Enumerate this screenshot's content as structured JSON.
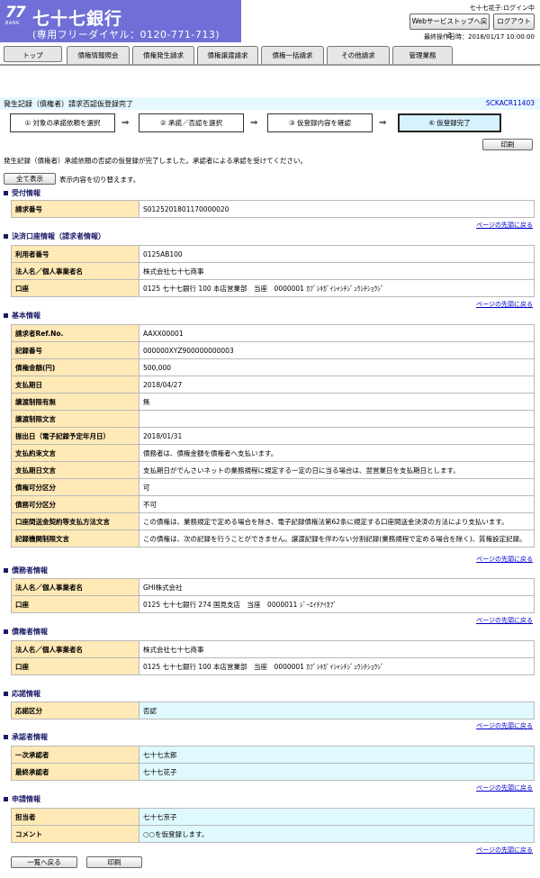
{
  "header": {
    "logo_number": "77",
    "logo_bank": "BANK",
    "bank_name": "七十七銀行",
    "dial": "(専用フリーダイヤル：0120-771-713)",
    "user_status": "七十七花子:ログイン中",
    "websvc_button": "Webサービストップへ戻る",
    "logout_button": "ログアウト",
    "last_operation": "最終操作日時：2018/01/17 10:00:00"
  },
  "tabs": [
    {
      "label": "トップ"
    },
    {
      "label": "債権情報照会"
    },
    {
      "label": "債権発生請求"
    },
    {
      "label": "債権譲渡請求"
    },
    {
      "label": "債権一括請求"
    },
    {
      "label": "その他請求"
    },
    {
      "label": "管理業務"
    }
  ],
  "page": {
    "title": "発生記録（債権者）請求否認仮登録完了",
    "screen_id": "SCKACR11403"
  },
  "steps": [
    {
      "label": "① 対象の承諾依頼を選択"
    },
    {
      "label": "② 承諾／否認を選択"
    },
    {
      "label": "③ 仮登録内容を確認"
    },
    {
      "label": "④ 仮登録完了"
    }
  ],
  "step_arrow": "⇒",
  "print_button": "印刷",
  "message": "発生記録（債権者）承諾依頼の否認の仮登録が完了しました。承認者による承認を受けてください。",
  "show_all_button": "全て表示",
  "show_all_note": "表示内容を切り替えます。",
  "top_link": "ページの先頭に戻る",
  "sections": {
    "receipt": {
      "title": "受付情報",
      "rows": [
        {
          "label": "請求番号",
          "value": "S0125201801170000020"
        }
      ]
    },
    "settlement": {
      "title": "決済口座情報（請求者情報）",
      "rows": [
        {
          "label": "利用者番号",
          "value": "0125AB100"
        },
        {
          "label": "法人名／個人事業者名",
          "value": "株式会社七十七商事"
        },
        {
          "label": "口座",
          "value": "0125 七十七銀行 100 本店営業部　当座　0000001 ｶﾌﾞｼｷｶﾞｲｼｬｼﾁｼﾞｭｳｼﾁｼｮｳｼﾞ"
        }
      ]
    },
    "basic": {
      "title": "基本情報",
      "rows": [
        {
          "label": "請求者Ref.No.",
          "value": "AAXX00001"
        },
        {
          "label": "記録番号",
          "value": "000000XYZ900000000003"
        },
        {
          "label": "債権金額(円)",
          "value": "500,000"
        },
        {
          "label": "支払期日",
          "value": "2018/04/27"
        },
        {
          "label": "譲渡制限有無",
          "value": "無"
        },
        {
          "label": "譲渡制限文言",
          "value": ""
        },
        {
          "label": "振出日（電子記録予定年月日）",
          "value": "2018/01/31"
        },
        {
          "label": "支払約束文言",
          "value": "債務者は、債権金額を債権者へ支払います。"
        },
        {
          "label": "支払期日文言",
          "value": "支払期日がでんさいネットの業務規程に規定する一定の日に当る場合は、翌営業日を支払期日とします。"
        },
        {
          "label": "債権可分区分",
          "value": "可"
        },
        {
          "label": "債務可分区分",
          "value": "不可"
        },
        {
          "label": "口座間送金契約等支払方法文言",
          "value": "この債権は、業務規定で定める場合を除き、電子記録債権法第62条に規定する口座間送金決済の方法により支払います。"
        },
        {
          "label": "記録機関制限文言",
          "value": "この債権は、次の記録を行うことができません。譲渡記録を伴わない分割記録(業務規程で定める場合を除く)、質権設定記録。"
        }
      ]
    },
    "debtor": {
      "title": "債務者情報",
      "rows": [
        {
          "label": "法人名／個人事業者名",
          "value": "GHI株式会社"
        },
        {
          "label": "口座",
          "value": "0125 七十七銀行 274 国見支店　当座　0000011 ｼﾞｰｴｲﾁｱｲｶﾌﾞ"
        }
      ]
    },
    "creditor": {
      "title": "債権者情報",
      "rows": [
        {
          "label": "法人名／個人事業者名",
          "value": "株式会社七十七商事"
        },
        {
          "label": "口座",
          "value": "0125 七十七銀行 100 本店営業部　当座　0000001 ｶﾌﾞｼｷｶﾞｲｼｬｼﾁｼﾞｭｳｼﾁｼｮｳｼﾞ"
        }
      ]
    },
    "response": {
      "title": "応諾情報",
      "rows": [
        {
          "label": "応諾区分",
          "value": "否認"
        }
      ]
    },
    "approver": {
      "title": "承認者情報",
      "rows": [
        {
          "label": "一次承認者",
          "value": "七十七太郎"
        },
        {
          "label": "最終承認者",
          "value": "七十七花子"
        }
      ]
    },
    "request": {
      "title": "申請情報",
      "rows": [
        {
          "label": "担当者",
          "value": "七十七京子"
        },
        {
          "label": "コメント",
          "value": "○○を仮登録します。"
        }
      ]
    }
  },
  "bottom": {
    "back_button": "一覧へ戻る",
    "print_button": "印刷"
  },
  "colors": {
    "brand": "#6f6fd7",
    "label_bg": "#ffe9b6",
    "highlight_bg": "#dff9ff",
    "title_bar_bg": "#e6f8ff",
    "section_head": "#1a1a66",
    "link": "#0000cc"
  }
}
